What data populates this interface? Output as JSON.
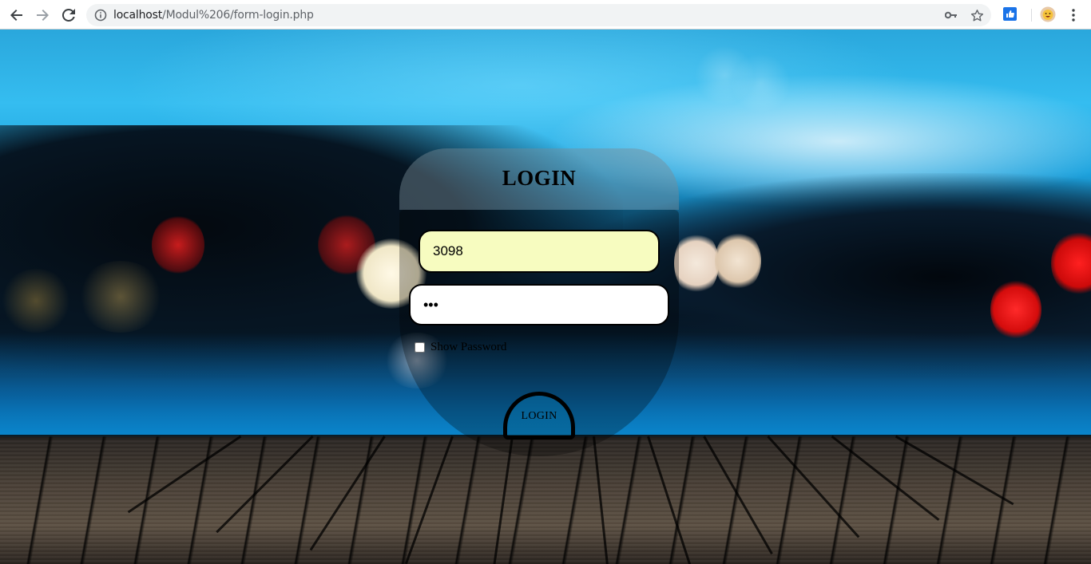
{
  "browser": {
    "url_host": "localhost",
    "url_path": "/Modul%206/form-login.php",
    "icons": [
      "back-arrow-icon",
      "forward-arrow-icon",
      "reload-icon",
      "info-icon",
      "key-icon",
      "star-icon",
      "extension-icon",
      "emoji-avatar-icon",
      "menu-kebab-icon"
    ]
  },
  "login": {
    "title": "LOGIN",
    "username_value": "3098",
    "password_value": "•••",
    "show_password_label": "Show Password",
    "show_password_checked": false,
    "submit_label": "LOGIN"
  },
  "colors": {
    "username_bg": "#f7fcc0",
    "password_bg": "#ffffff",
    "accent_sky": "#1da3de"
  }
}
